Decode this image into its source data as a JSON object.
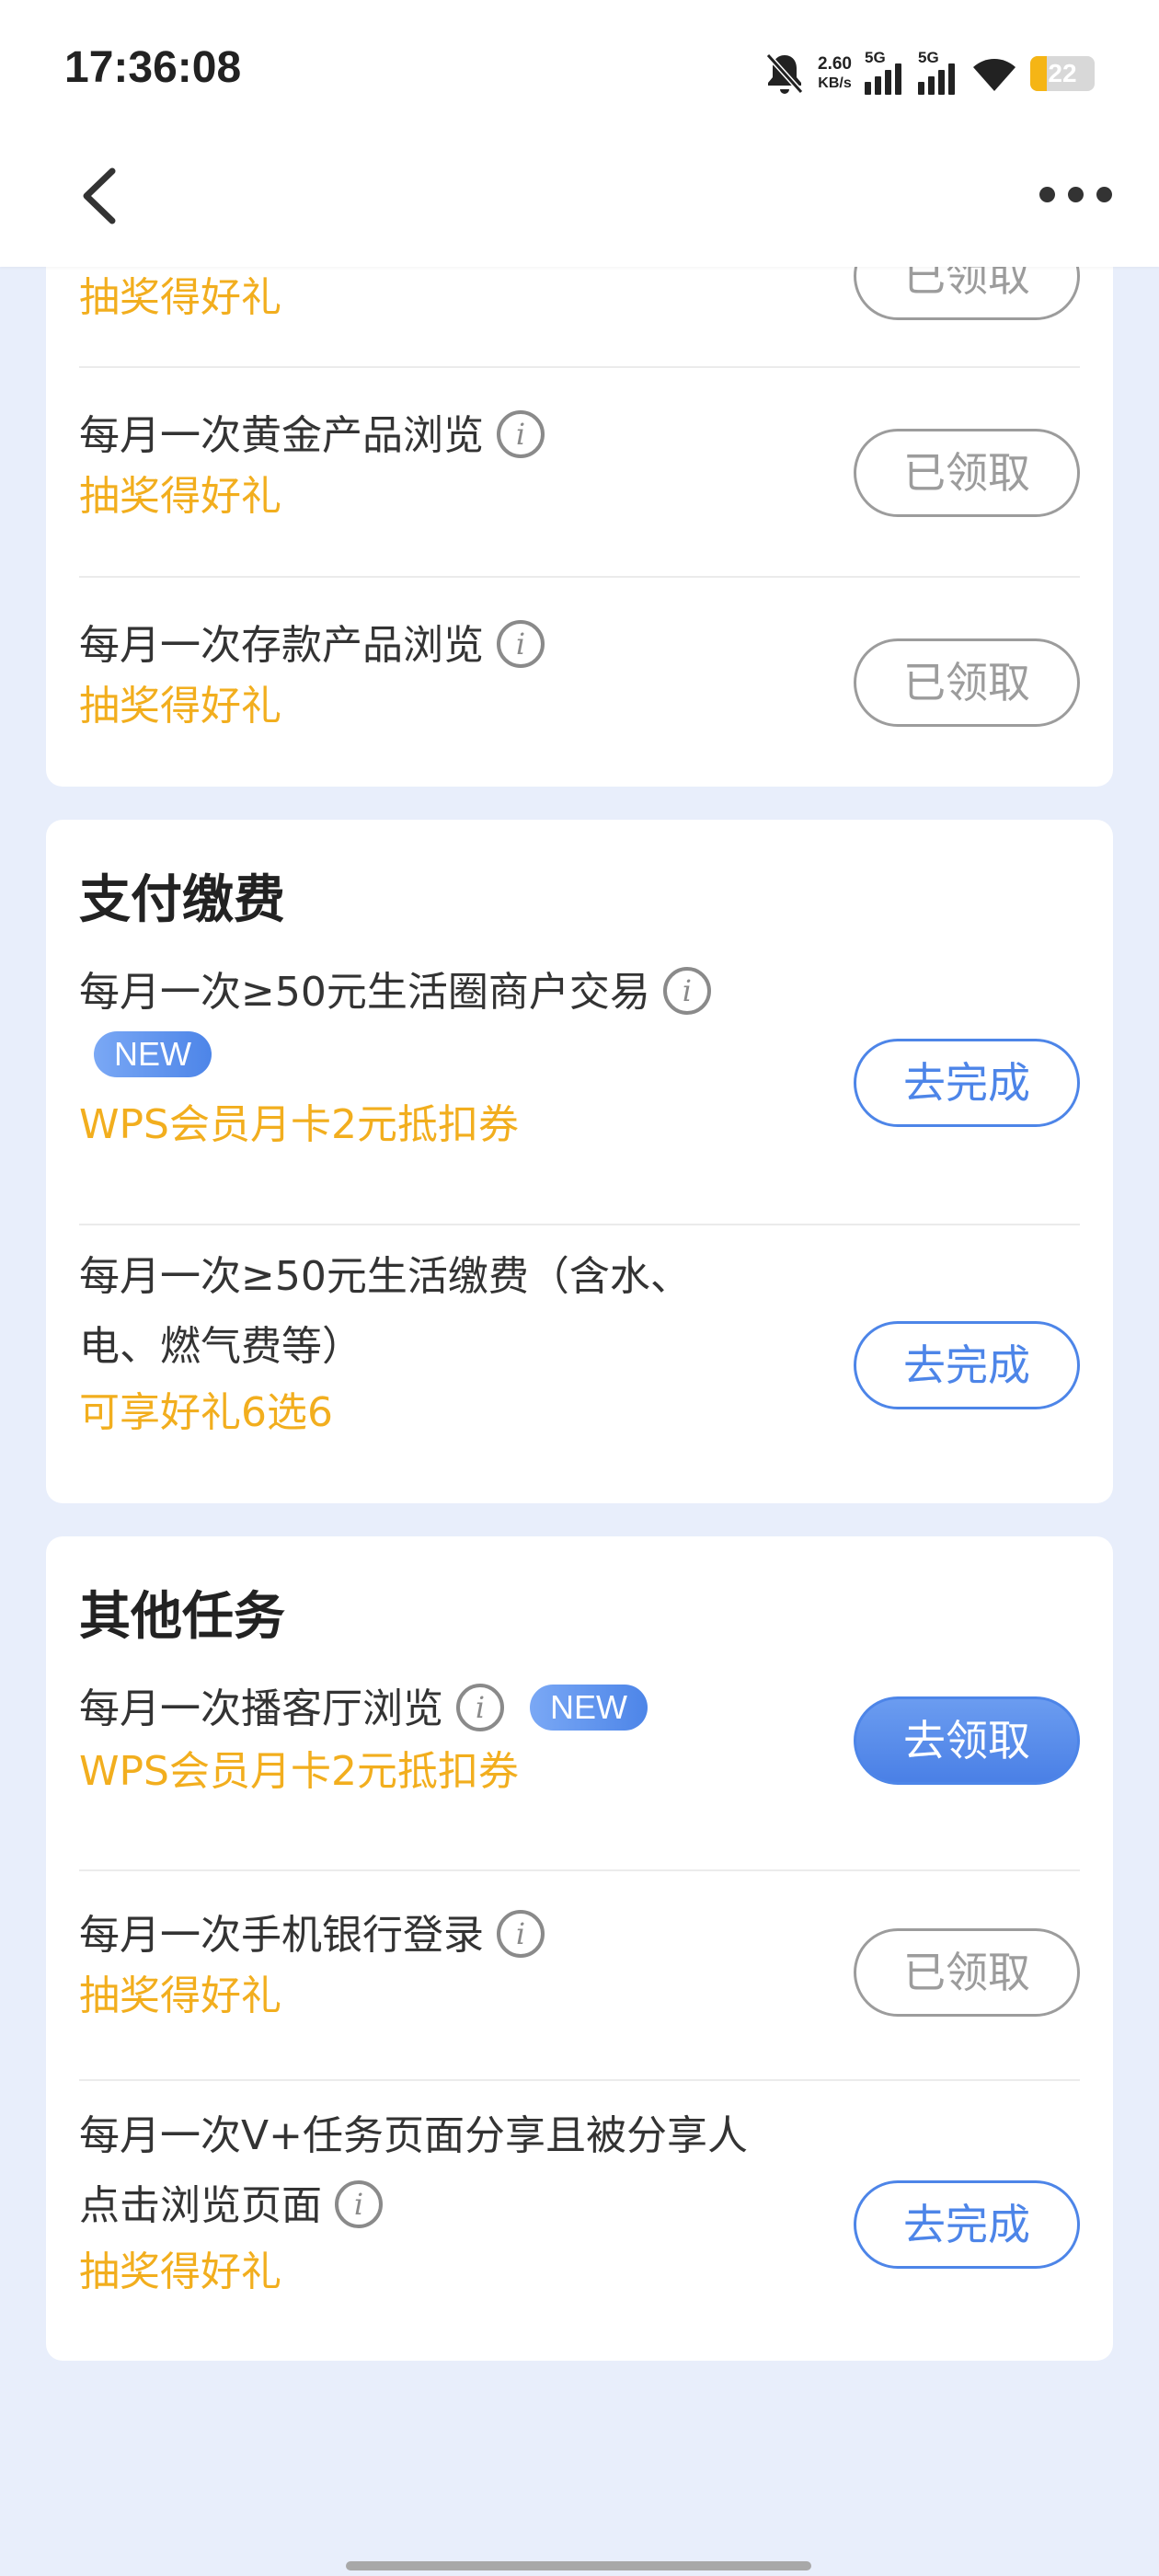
{
  "status_bar": {
    "time": "17:36:08",
    "net_speed_value": "2.60",
    "net_speed_unit": "KB/s",
    "signal_1_label": "5G",
    "signal_2_label": "5G",
    "battery_level": "22",
    "icons": [
      "bell-off-icon",
      "signal-icon",
      "signal-icon",
      "wifi-icon",
      "battery-icon"
    ]
  },
  "nav": {
    "back_icon": "chevron-left-icon",
    "more_icon": "more-horizontal-icon"
  },
  "sections": [
    {
      "title": "",
      "tasks": [
        {
          "name": "",
          "reward": "抽奖得好礼",
          "button": "已领取",
          "state": "claimed"
        },
        {
          "name": "每月一次黄金产品浏览",
          "reward": "抽奖得好礼",
          "button": "已领取",
          "state": "claimed"
        },
        {
          "name": "每月一次存款产品浏览",
          "reward": "抽奖得好礼",
          "button": "已领取",
          "state": "claimed"
        }
      ]
    },
    {
      "title": "支付缴费",
      "tasks": [
        {
          "name": "每月一次≥50元生活圈商户交易",
          "badge": "NEW",
          "reward": "WPS会员月卡2元抵扣券",
          "button": "去完成",
          "state": "todo"
        },
        {
          "name_line1": "每月一次≥50元生活缴费（含水、",
          "name_line2": "电、燃气费等）",
          "reward": "可享好礼6选6",
          "button": "去完成",
          "state": "todo"
        }
      ]
    },
    {
      "title": "其他任务",
      "tasks": [
        {
          "name": "每月一次播客厅浏览",
          "badge": "NEW",
          "reward": "WPS会员月卡2元抵扣券",
          "button": "去领取",
          "state": "claim"
        },
        {
          "name": "每月一次手机银行登录",
          "reward": "抽奖得好礼",
          "button": "已领取",
          "state": "claimed"
        },
        {
          "name_line1": "每月一次V+任务页面分享且被分享人",
          "name_line2": "点击浏览页面",
          "reward": "抽奖得好礼",
          "button": "去完成",
          "state": "todo"
        }
      ]
    }
  ],
  "colors": {
    "page_bg": "#e8eefb",
    "reward": "#f2ae1e",
    "accent_blue": "#4d85e8",
    "claimed_gray": "#9c9c9c"
  }
}
